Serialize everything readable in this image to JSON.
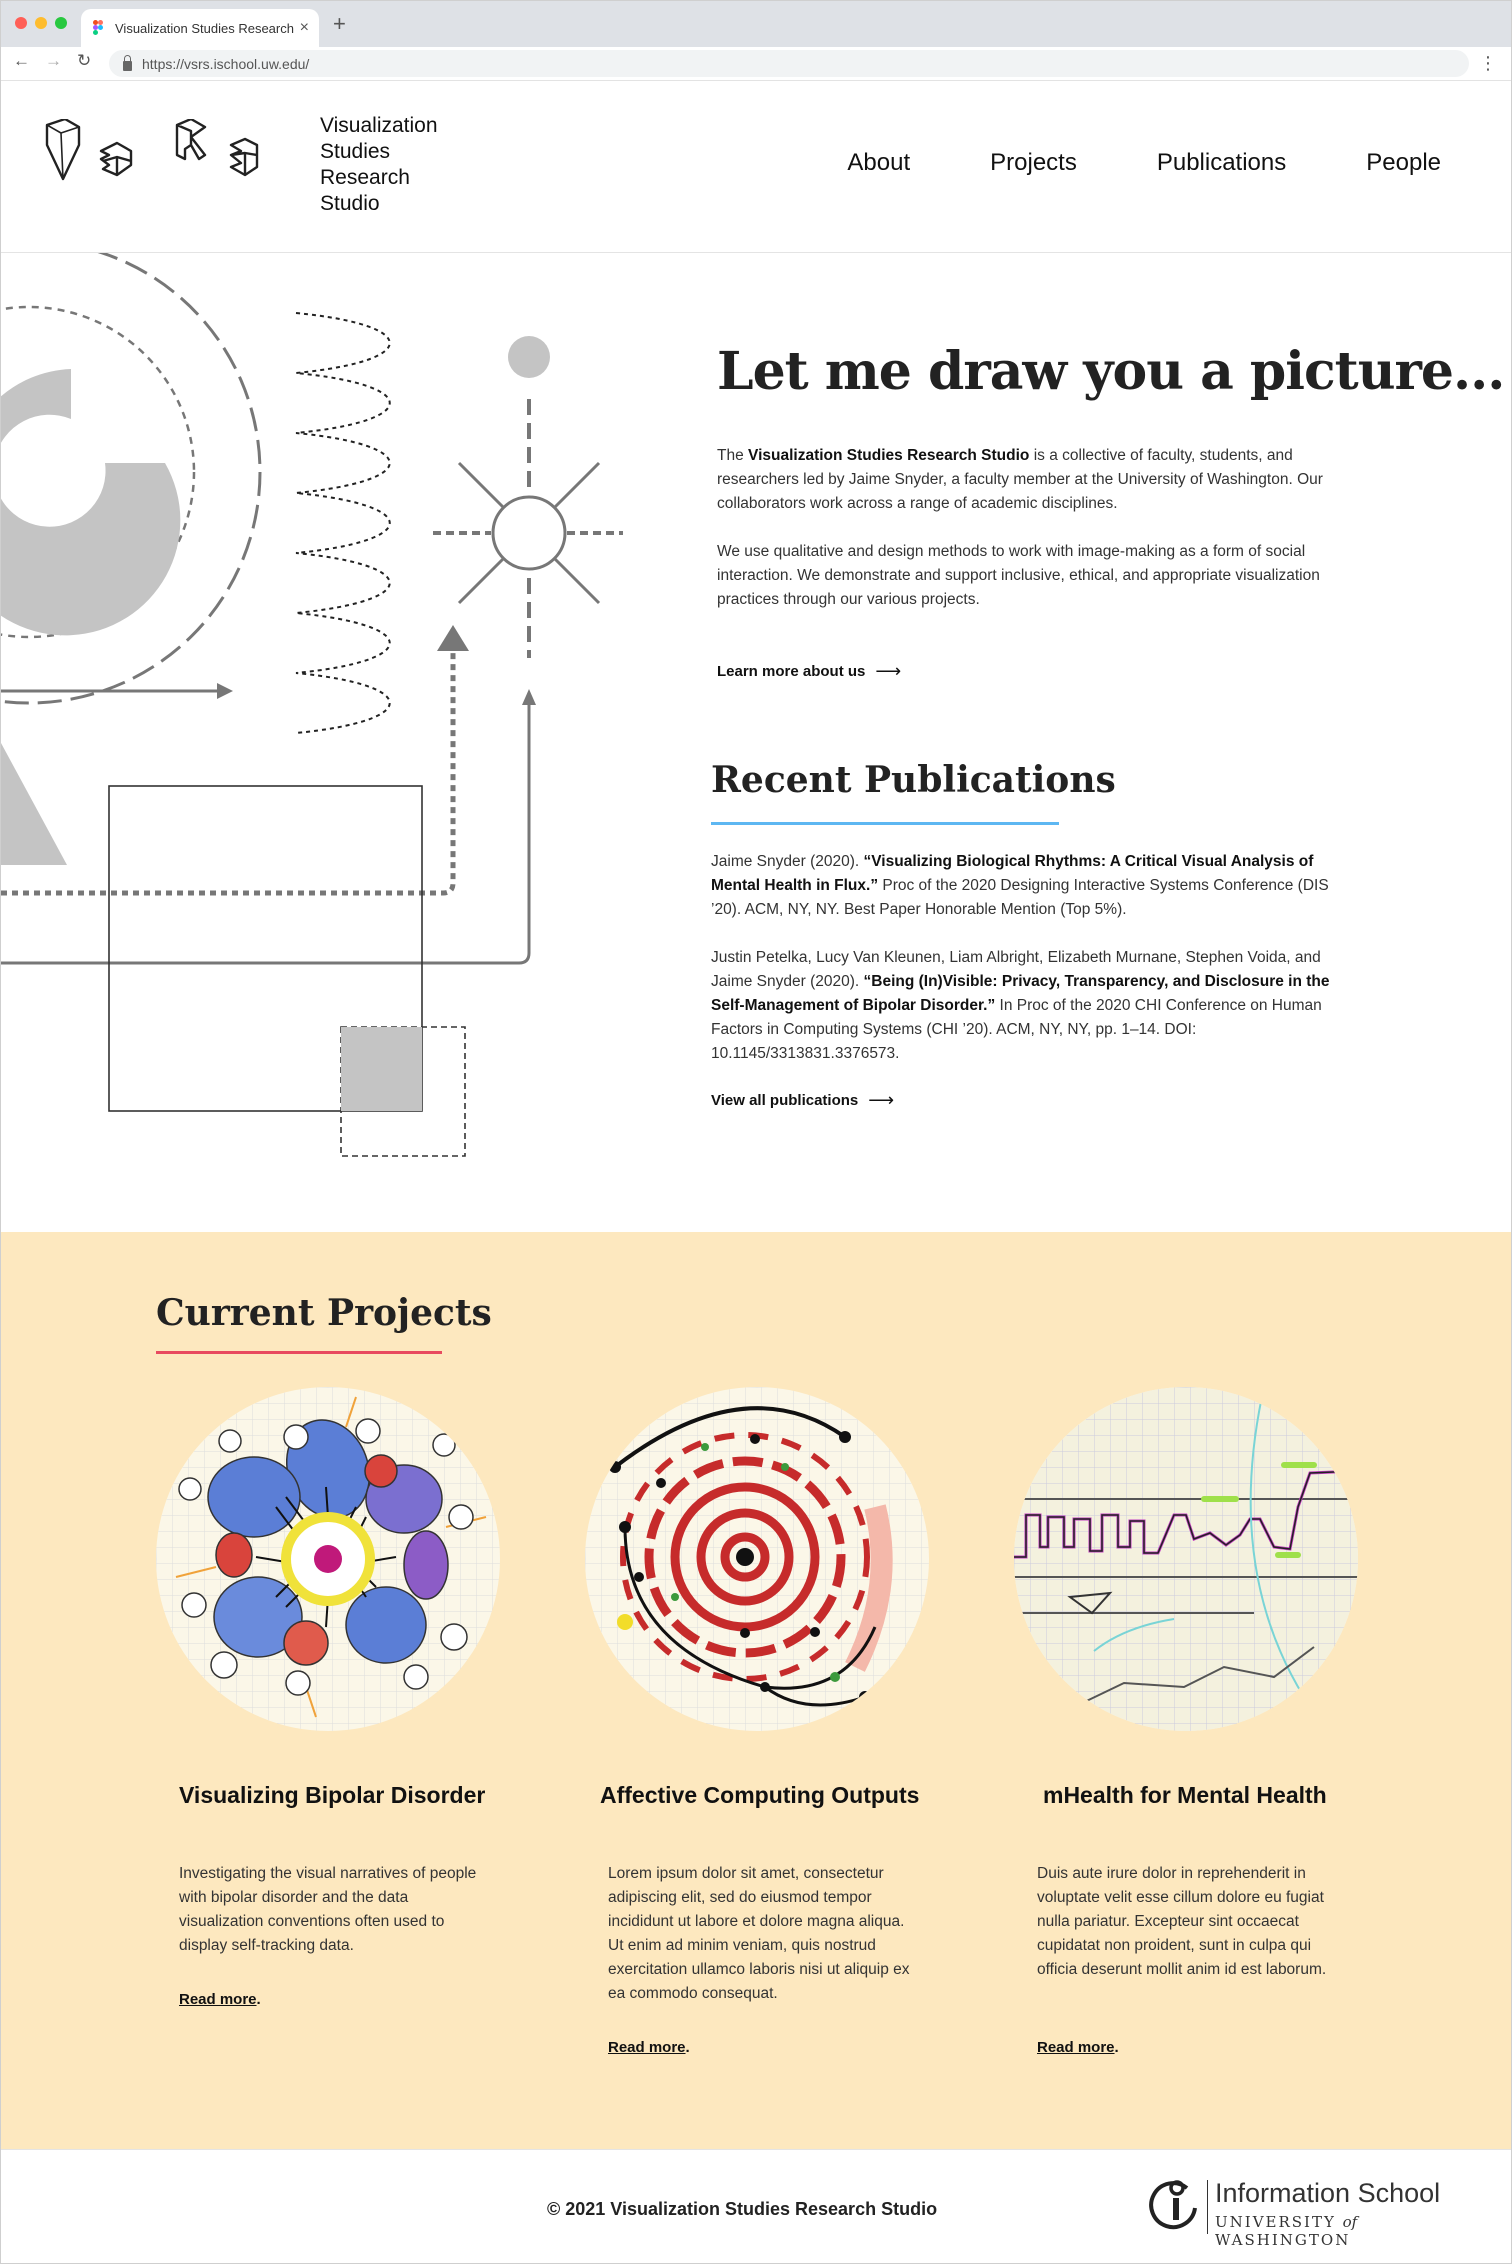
{
  "browser": {
    "tab_title": "Visualization Studies Research Studio",
    "url": "https://vsrs.ischool.uw.edu/"
  },
  "site": {
    "logo_lines": [
      "Visualization",
      "Studies",
      "Research",
      "Studio"
    ],
    "nav": [
      "About",
      "Projects",
      "Publications",
      "People"
    ]
  },
  "hero": {
    "title": "Let me draw you a picture...",
    "intro_bold": "Visualization Studies Research Studio",
    "intro_pre": "The ",
    "intro_post": " is a collective of faculty, students, and researchers led by Jaime Snyder, a faculty member at the University of Washington. Our collaborators work across a range of academic disciplines.",
    "paragraph2": "We use qualitative and design methods to work with image-making as a form of social interaction. We demonstrate and support inclusive, ethical, and appropriate visualization practices through our various projects.",
    "learn_more": "Learn more about us"
  },
  "publications": {
    "title": "Recent Publications",
    "items": [
      {
        "authors": "Jaime Snyder (2020). ",
        "title": "“Visualizing Biological Rhythms: A Critical Visual Analysis of Mental Health in Flux.”",
        "venue": " Proc of the 2020 Designing Interactive Systems Conference (DIS ’20). ACM, NY, NY. Best Paper Honorable Mention (Top 5%)."
      },
      {
        "authors": "Justin Petelka, Lucy Van Kleunen, Liam Albright, Elizabeth Murnane, Stephen Voida, and Jaime Snyder (2020). ",
        "title": "“Being (In)Visible: Privacy, Transparency, and Disclosure in the Self-Management of Bipolar Disorder.”",
        "venue": " In Proc of the 2020 CHI Conference on Human Factors in Computing Systems (CHI ’20). ACM, NY, NY, pp. 1–14. DOI: 10.1145/3313831.3376573."
      }
    ],
    "view_all": "View all publications"
  },
  "projects": {
    "title": "Current Projects",
    "items": [
      {
        "name": "Visualizing Bipolar Disorder",
        "desc": "Investigating the visual narratives of people with bipolar disorder and the data visualization conventions often used to display self-tracking data.",
        "read_more": "Read more"
      },
      {
        "name": "Affective Computing Outputs",
        "desc": "Lorem ipsum dolor sit amet, consectetur adipiscing elit, sed do eiusmod tempor incididunt ut labore et dolore magna aliqua. Ut enim ad minim veniam, quis nostrud exercitation ullamco laboris nisi ut aliquip ex ea commodo consequat.",
        "read_more": "Read more"
      },
      {
        "name": "mHealth for Mental Health",
        "desc": "Duis aute irure dolor in reprehenderit in voluptate velit esse cillum dolore eu fugiat nulla pariatur. Excepteur sint occaecat cupidatat non proident, sunt in culpa qui officia deserunt mollit anim id est laborum.",
        "read_more": "Read more"
      }
    ]
  },
  "footer": {
    "copyright": "© 2021 Visualization Studies Research Studio",
    "ischool_name": "Information School",
    "ischool_uni_pre": "UNIVERSITY ",
    "ischool_uni_of": "of",
    "ischool_uni_post": " WASHINGTON"
  },
  "colors": {
    "projects_bg": "#fde8bf",
    "publications_rule": "#5db7f2",
    "projects_rule": "#e84a5f"
  }
}
